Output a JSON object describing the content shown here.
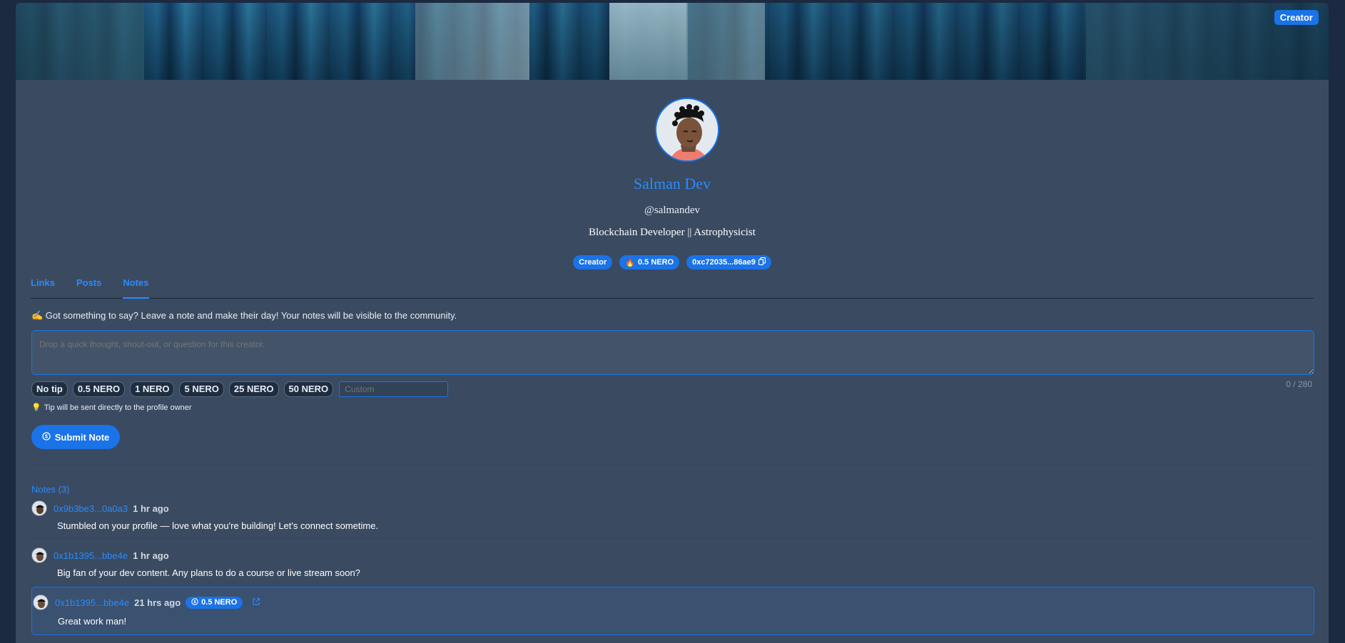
{
  "colors": {
    "accent": "#1a73e8",
    "link": "#2a8bff",
    "panel": "#3a4a60"
  },
  "corner_badge": "Creator",
  "profile": {
    "name": "Salman Dev",
    "handle": "@salmandev",
    "bio": "Blockchain Developer || Astrophysicist",
    "badges": {
      "role": "Creator",
      "tip_amount": "0.5 NERO",
      "wallet": "0xc72035...86ae9"
    }
  },
  "tabs": [
    {
      "label": "Links"
    },
    {
      "label": "Posts"
    },
    {
      "label": "Notes"
    }
  ],
  "active_tab": "Notes",
  "notes_form": {
    "intro": "✍️ Got something to say? Leave a note and make their day! Your notes will be visible to the community.",
    "placeholder": "Drop a quick thought, shout-out, or question for this creator.",
    "counter": "0 / 280",
    "tip_options": [
      "No tip",
      "0.5 NERO",
      "1 NERO",
      "5 NERO",
      "25 NERO",
      "50 NERO"
    ],
    "custom_placeholder": "Custom",
    "tip_hint": "Tip will be sent directly to the profile owner",
    "submit_label": "Submit Note"
  },
  "notes": {
    "title": "Notes (3)",
    "items": [
      {
        "address": "0x9b3be3...0a0a3",
        "time": "1 hr ago",
        "text": "Stumbled on your profile — love what you're building! Let's connect sometime."
      },
      {
        "address": "0x1b1395...bbe4e",
        "time": "1 hr ago",
        "text": "Big fan of your dev content. Any plans to do a course or live stream soon?"
      },
      {
        "address": "0x1b1395...bbe4e",
        "time": "21 hrs ago",
        "tip": "0.5 NERO",
        "text": "Great work man!"
      }
    ]
  },
  "icons": {
    "fire": "fire-icon",
    "copy": "copy-icon",
    "bulb": "lightbulb-icon",
    "dollar": "dollar-coin-icon",
    "external": "external-link-icon"
  }
}
